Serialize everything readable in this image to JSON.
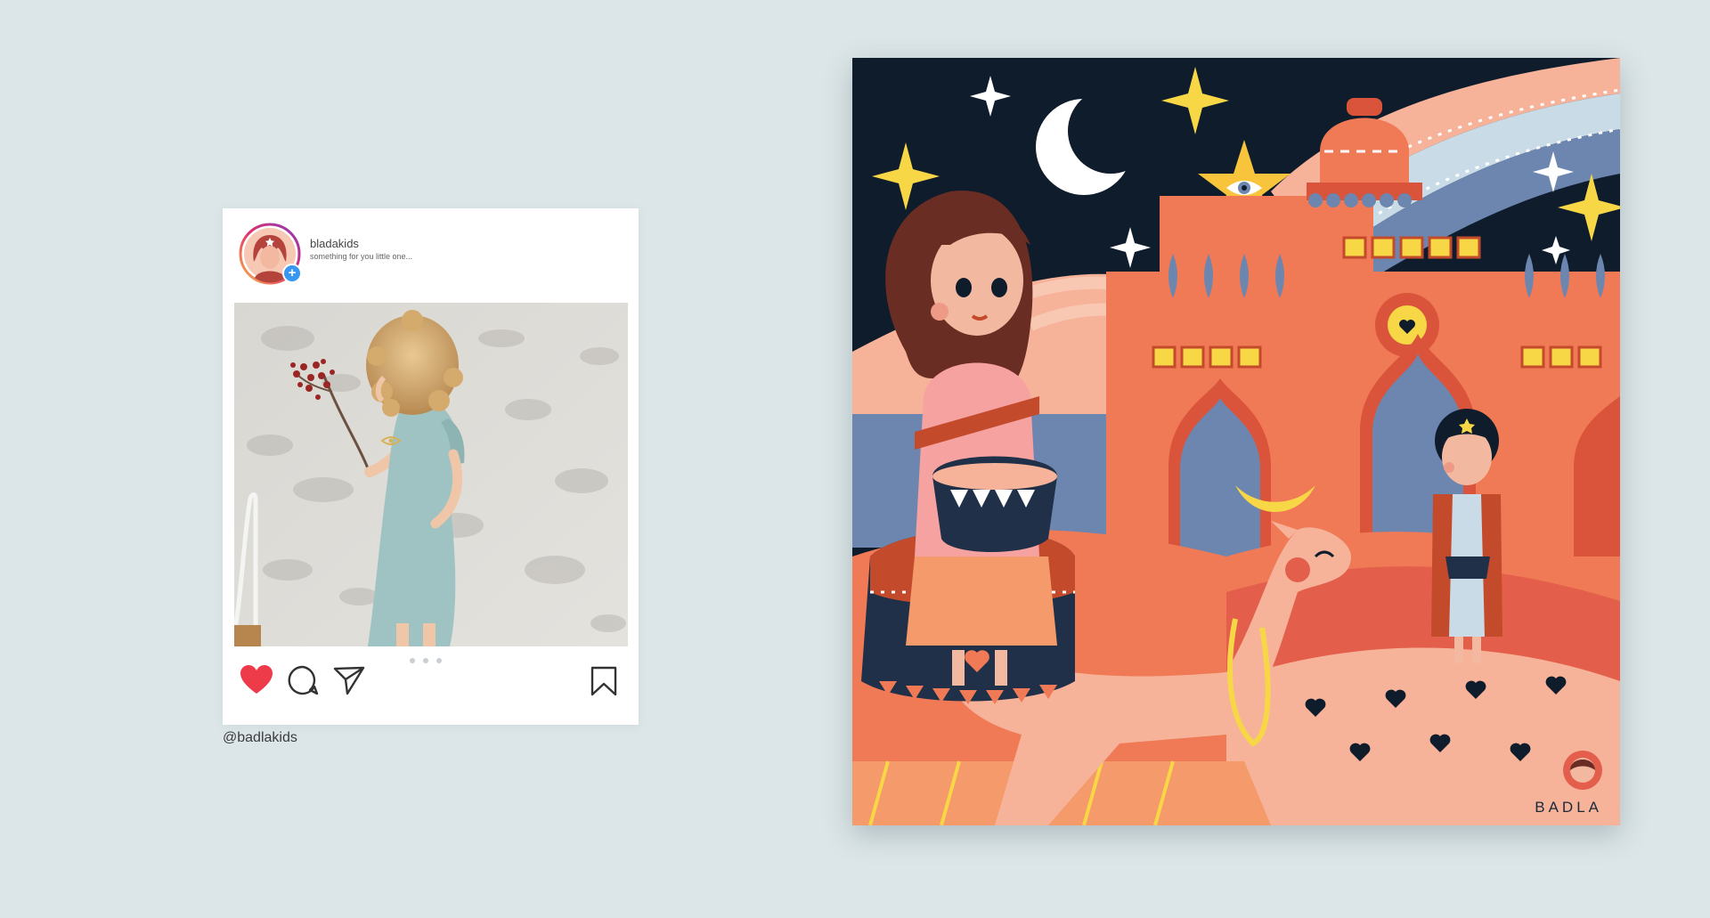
{
  "instagram_post": {
    "username": "bladakids",
    "caption": "something for you little one...",
    "carousel_dots": 3
  },
  "handle": "@badlakids",
  "illustration": {
    "brand": "BADLA"
  },
  "colors": {
    "background": "#dce6e8",
    "night_sky": "#0f1c2c",
    "star_yellow": "#f7d746",
    "coral": "#f07a55",
    "peach": "#f6b39a",
    "slate_blue": "#6c86b0",
    "heart_red": "#ed3b4a"
  },
  "icons": [
    "heart-icon",
    "comment-icon",
    "share-icon",
    "bookmark-icon",
    "plus-icon"
  ]
}
